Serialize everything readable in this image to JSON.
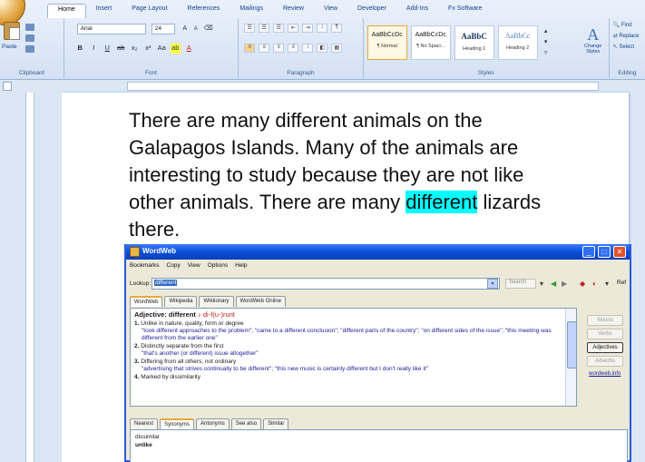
{
  "ribbon": {
    "tabs": [
      "Home",
      "Insert",
      "Page Layout",
      "References",
      "Mailings",
      "Review",
      "View",
      "Developer",
      "Add-Ins",
      "Fx Software"
    ],
    "active_tab": "Home",
    "clipboard": {
      "paste_label": "Paste",
      "group_label": "Clipboard"
    },
    "font": {
      "name": "Arial",
      "size": "24",
      "group_label": "Font"
    },
    "paragraph": {
      "group_label": "Paragraph"
    },
    "styles": {
      "group_label": "Styles",
      "items": [
        {
          "sample": "AaBbCcDc",
          "name": "¶ Normal"
        },
        {
          "sample": "AaBbCcDc",
          "name": "¶ No Spaci..."
        },
        {
          "sample": "AaBbC",
          "name": "Heading 1"
        },
        {
          "sample": "AaBbCc",
          "name": "Heading 2"
        }
      ],
      "change_styles": "Change Styles"
    },
    "editing": {
      "find": "Find",
      "replace": "Replace",
      "select": "Select",
      "group_label": "Editing"
    }
  },
  "document": {
    "text_before": "There are many different animals on the Galapagos Islands.  Many of the animals are interesting to study because they are not like other animals.  There are many ",
    "highlight": "different",
    "text_after": " lizards there."
  },
  "wordweb": {
    "title": "WordWeb",
    "menu": [
      "Bookmarks",
      "Copy",
      "View",
      "Options",
      "Help"
    ],
    "lookup_label": "Lookup:",
    "lookup_value": "different",
    "search_placeholder": "Search",
    "ref_label": "Ref",
    "source_tabs": [
      "WordWeb",
      "Wikipedia",
      "Wiktionary",
      "WordWeb Online"
    ],
    "active_source_tab": "WordWeb",
    "definition": {
      "head": "Adjective: different",
      "pron": "di-f(u-)runt",
      "senses": [
        {
          "num": "1.",
          "gloss": "Unlike in nature, quality, form or degree",
          "example": "\"took different approaches to the problem\"; \"came to a different conclusion\"; \"different parts of the country\"; \"on different sides of the issue\"; \"this meeting was different from the earlier one\""
        },
        {
          "num": "2.",
          "gloss": "Distinctly separate from the first",
          "example": "\"that's another (or different) issue altogether\""
        },
        {
          "num": "3.",
          "gloss": "Differing from all others; not ordinary",
          "example": "\"advertising that strives continually to be different\"; \"this new music is certainly different but I don't really like it\""
        },
        {
          "num": "4.",
          "gloss": "Marked by dissimilarity",
          "example": ""
        }
      ]
    },
    "side_buttons": {
      "nouns": "Nouns",
      "verbs": "Verbs",
      "adjectives": "Adjectives",
      "adverbs": "Adverbs"
    },
    "link": "wordweb.info",
    "relation_tabs": [
      "Nearest",
      "Synonyms",
      "Antonyms",
      "See also",
      "Similar"
    ],
    "active_relation_tab": "Synonyms",
    "synonyms": [
      "dissimilar",
      "unlike"
    ]
  }
}
